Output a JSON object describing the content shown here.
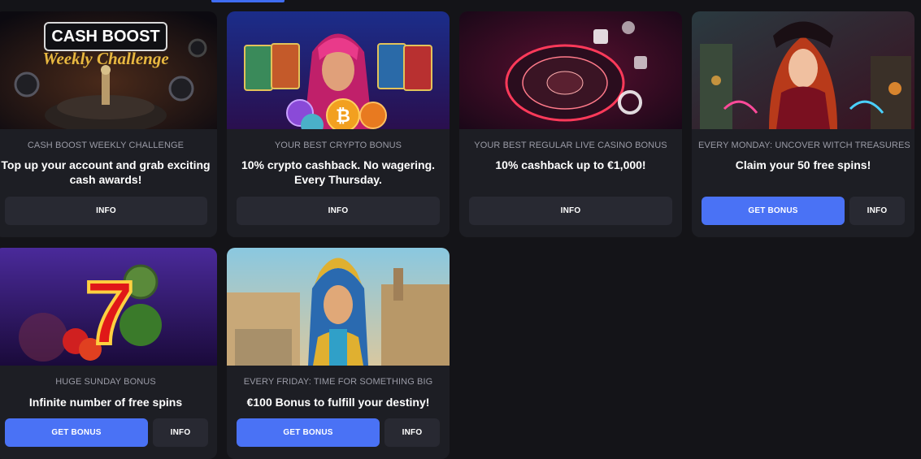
{
  "cards": [
    {
      "art_label": "CASH BOOST",
      "art_script": "Weekly Challenge",
      "subtitle": "CASH BOOST WEEKLY CHALLENGE",
      "headline": "Top up your account and grab exciting cash awards!",
      "info_label": "INFO"
    },
    {
      "subtitle": "YOUR BEST CRYPTO BONUS",
      "headline": "10% crypto cashback. No wagering. Every Thursday.",
      "info_label": "INFO"
    },
    {
      "subtitle": "YOUR BEST REGULAR LIVE CASINO BONUS",
      "headline": "10% cashback up to €1,000!",
      "info_label": "INFO"
    },
    {
      "subtitle": "EVERY MONDAY: UNCOVER WITCH TREASURES",
      "headline": "Claim your 50 free spins!",
      "get_label": "GET BONUS",
      "info_label": "INFO"
    },
    {
      "subtitle": "HUGE SUNDAY BONUS",
      "headline": "Infinite number of free spins",
      "get_label": "GET BONUS",
      "info_label": "INFO"
    },
    {
      "subtitle": "EVERY FRIDAY: TIME FOR SOMETHING BIG",
      "headline": "€100 Bonus to fulfill your destiny!",
      "get_label": "GET BONUS",
      "info_label": "INFO"
    }
  ],
  "colors": {
    "page_bg": "#141418",
    "card_bg": "#1d1e24",
    "primary_button": "#4a72f5",
    "secondary_button": "#282932",
    "subtitle_text": "#9a9ba6"
  }
}
